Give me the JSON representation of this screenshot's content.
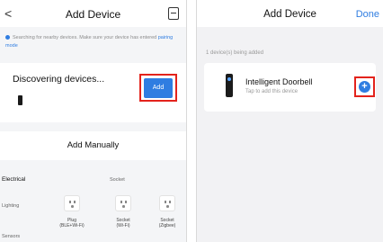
{
  "left": {
    "title": "Add Device",
    "back_glyph": "<",
    "hint_text": "Searching for nearby devices. Make sure your device has entered",
    "hint_link": "pairing mode",
    "discovering": "Discovering devices...",
    "add_label": "Add",
    "add_manually": "Add Manually",
    "categories": [
      "Electrical",
      "Lighting",
      "Sensors"
    ],
    "sub_category": "Socket",
    "devices": [
      {
        "label": "Plug\n(BLE+Wi-Fi)"
      },
      {
        "label": "Socket\n(Wi-Fi)"
      },
      {
        "label": "Socket\n(Zigbee)"
      }
    ]
  },
  "right": {
    "title": "Add Device",
    "done_label": "Done",
    "hint": "1 device(s) being added",
    "device_name": "Intelligent Doorbell",
    "device_sub": "Tap to add this device",
    "plus_glyph": "+"
  },
  "colors": {
    "accent": "#2f7de1",
    "highlight": "#e3231c"
  },
  "icons": [
    "back-icon",
    "scan-icon",
    "info-icon",
    "plug-icon",
    "doorbell-icon",
    "add-circle-icon"
  ]
}
